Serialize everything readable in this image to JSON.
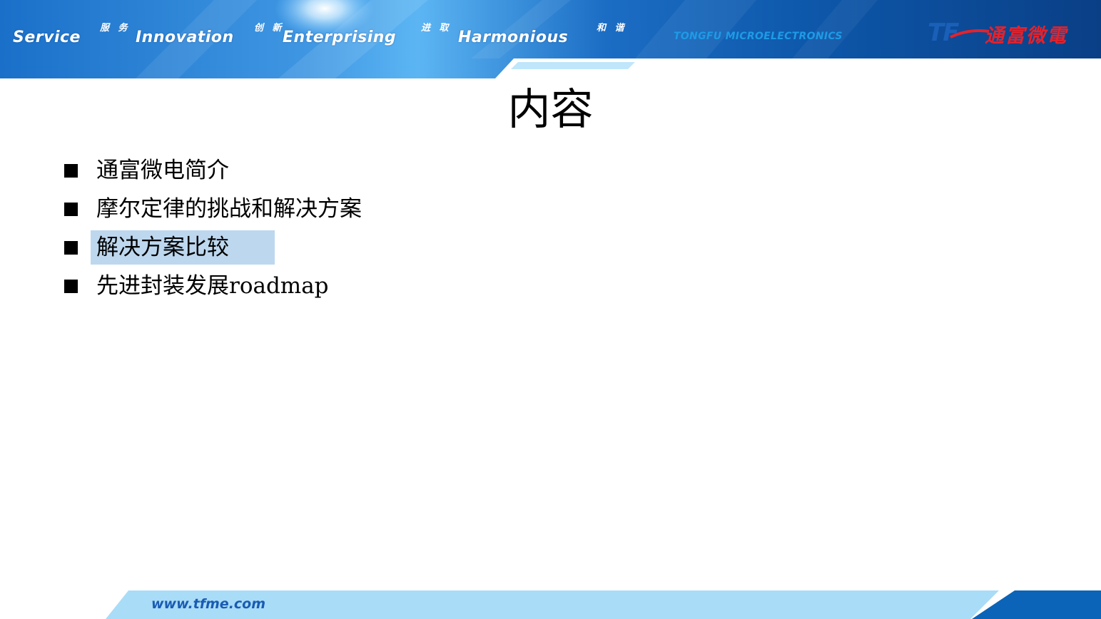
{
  "header": {
    "motto": [
      {
        "en": "Service",
        "cn": "服 务"
      },
      {
        "en": "Innovation",
        "cn": "创 新"
      },
      {
        "en": "Enterprising",
        "cn": "进 取"
      },
      {
        "en": "Harmonious",
        "cn": "和 谐"
      }
    ],
    "company_en": "TONGFU MICROELECTRONICS",
    "logo_mark": "TF",
    "logo_cn": "通富微電"
  },
  "title": "内容",
  "agenda": [
    {
      "label": "通富微电简介",
      "highlighted": false
    },
    {
      "label": "摩尔定律的挑战和解决方案",
      "highlighted": false
    },
    {
      "label": "解决方案比较",
      "highlighted": true
    },
    {
      "label": "先进封装发展roadmap",
      "highlighted": false
    }
  ],
  "footer": {
    "website": "www.tfme.com"
  },
  "colors": {
    "banner_dark": "#0a4fa0",
    "banner_light": "#4fa8ec",
    "highlight": "#bdd7ee",
    "footer_band": "#a9dcf7",
    "logo_red": "#e4222b"
  }
}
